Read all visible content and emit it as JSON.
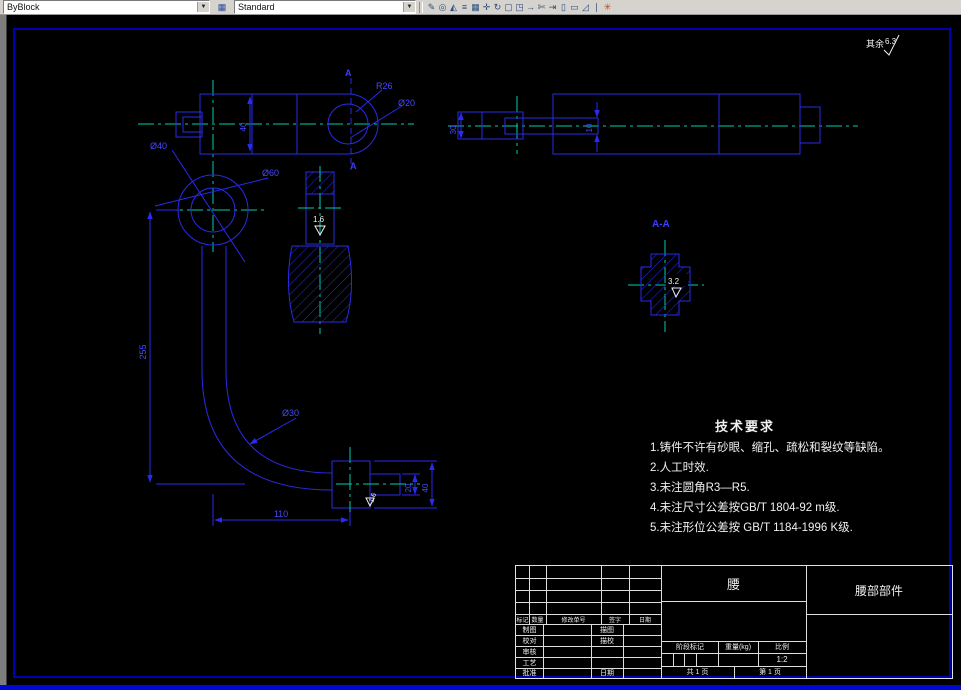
{
  "toolbar": {
    "color_combo": "ByBlock",
    "style_combo": "Standard",
    "icon_glyphs": [
      "✎",
      "◎",
      "◭",
      "≡",
      "▦",
      "✛",
      "↻",
      "▢",
      "◳",
      "→",
      "✄",
      "⇥",
      "▯",
      "▭",
      "◿",
      "∣",
      "✳"
    ]
  },
  "annotations": {
    "general_prefix": "其余",
    "general_value": "6.3",
    "section_cut_top": "A",
    "section_cut_bottom": "A",
    "section_view_label": "A-A",
    "rough_boss": "1.6",
    "rough_section": "3.2",
    "rough_block": "1.6"
  },
  "tech": {
    "title": "技术要求",
    "items": [
      "1.铸件不许有砂眼、缩孔、疏松和裂纹等缺陷。",
      "2.人工时效.",
      "3.未注圆角R3—R5.",
      "4.未注尺寸公差按GB/T 1804-92 m级.",
      "5.未注形位公差按 GB/T 1184-1996 K级."
    ]
  },
  "dims": {
    "end_radius": "R26",
    "bore_dia": "Ø20",
    "body_width": "40",
    "hub_inner": "Ø40",
    "hub_outer": "Ø60",
    "arm_height": "255",
    "arm_reach": "110",
    "tube_dia": "Ø30",
    "tongue_height": "20",
    "block_height": "40",
    "stub_dia": "30",
    "key_dim": "10"
  },
  "title_block": {
    "part_name": "腰",
    "component_name": "腰部部件",
    "rev_header": [
      "标记",
      "数量",
      "修改单号",
      "签字",
      "日期"
    ],
    "sign_left": [
      "制图",
      "校对",
      "审核",
      "工艺",
      "批准"
    ],
    "sign_right": [
      "描图",
      "描校",
      "",
      "",
      "日期"
    ],
    "stage_label": "阶段标记",
    "weight_label": "重量(kg)",
    "scale_label": "比例",
    "scale_value": "1:2",
    "sheets_total": "共 1 页",
    "sheet_number": "第 1 页"
  }
}
